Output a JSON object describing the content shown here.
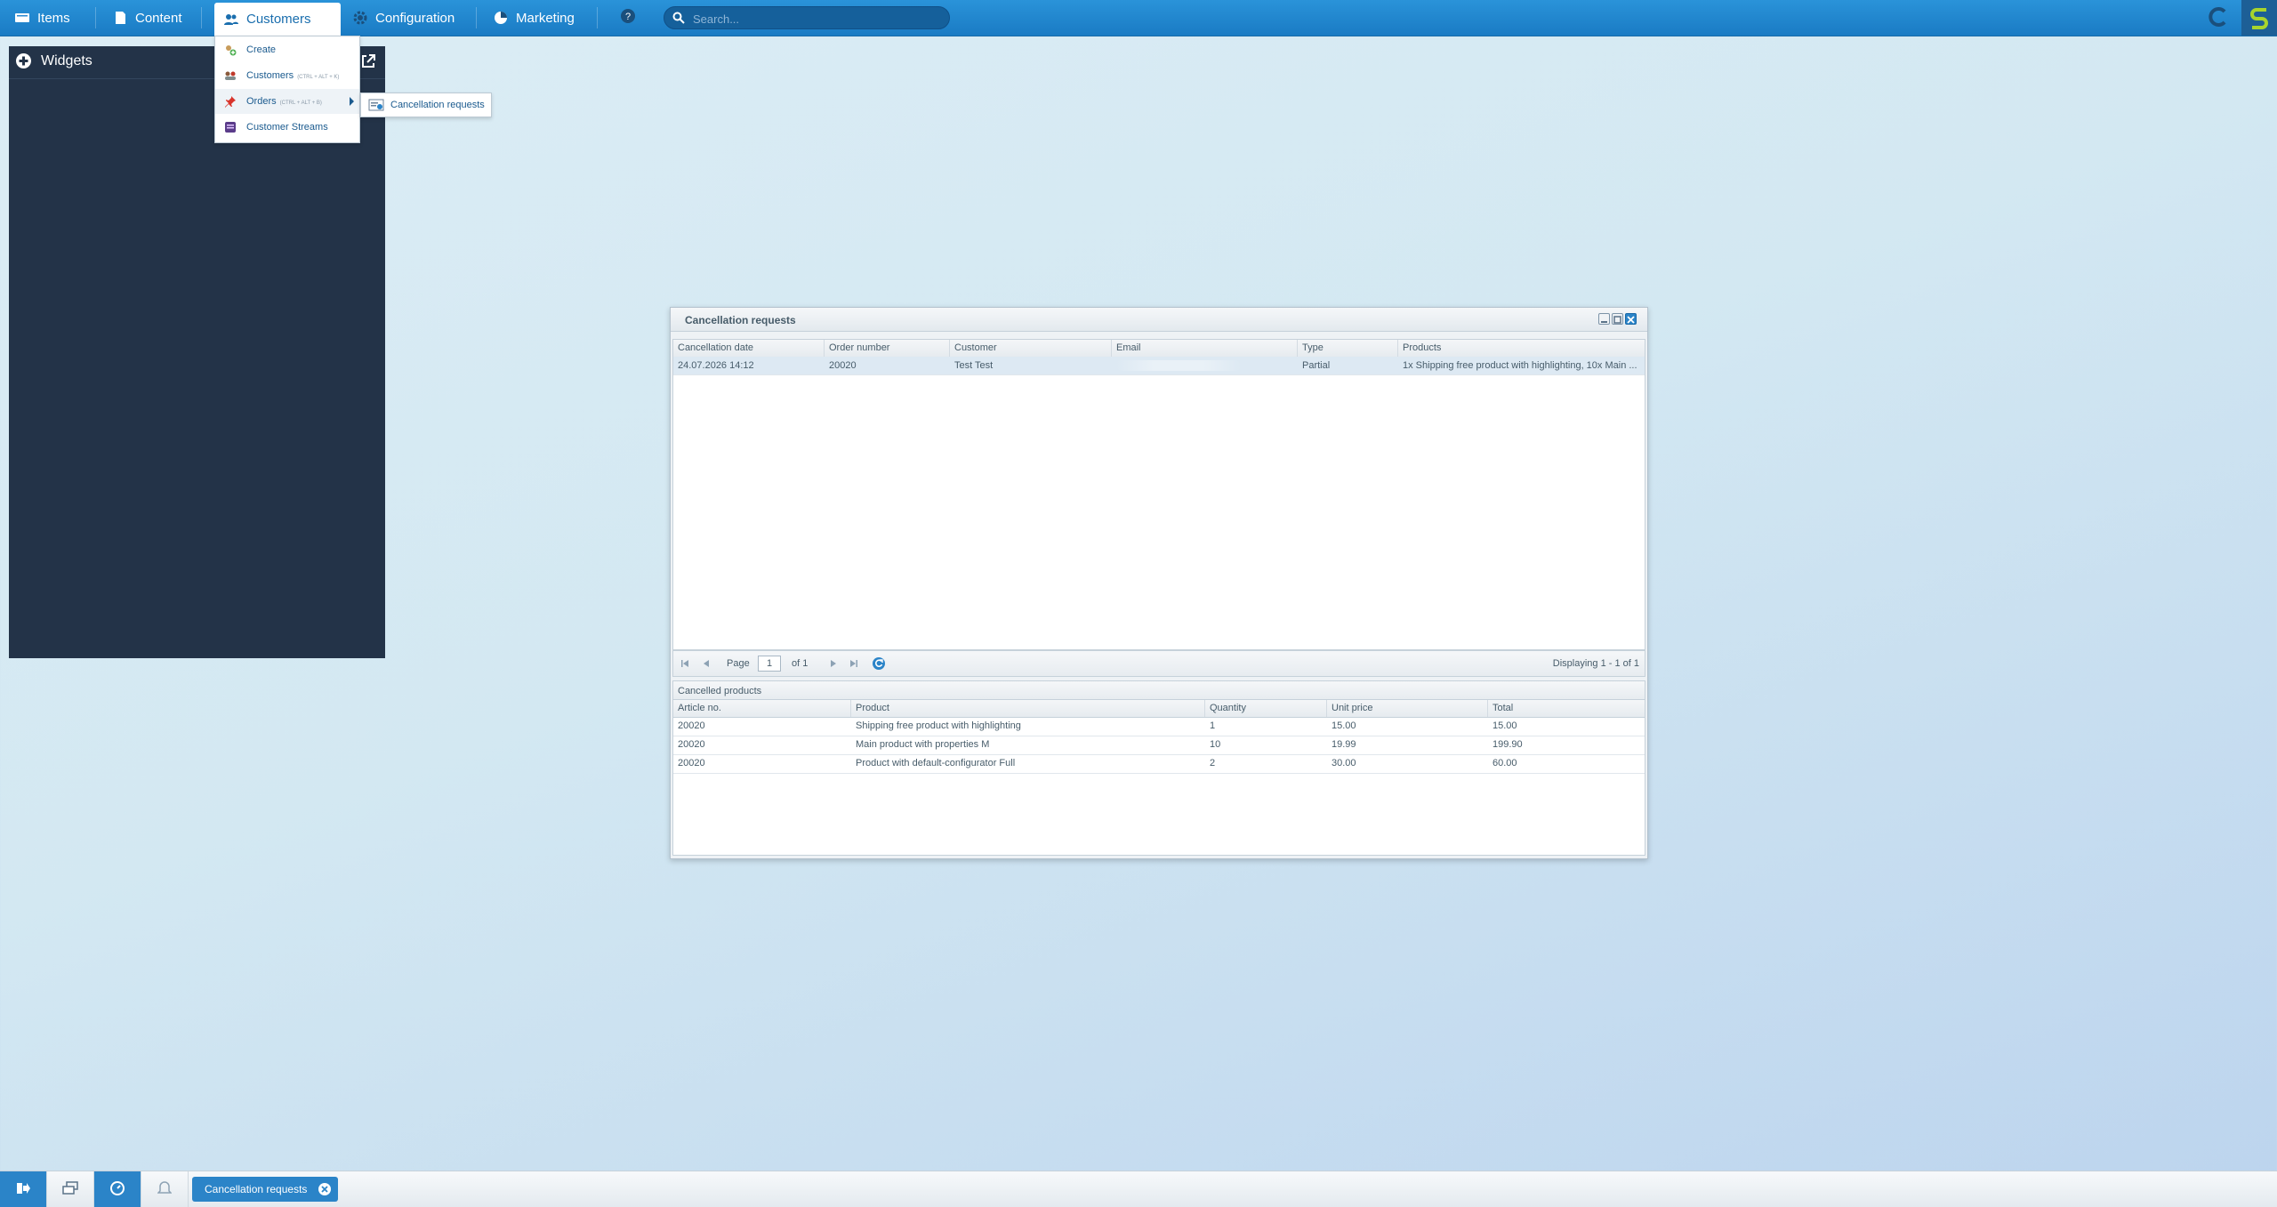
{
  "topbar": {
    "nav": [
      {
        "label": "Items",
        "icon": "items-icon"
      },
      {
        "label": "Content",
        "icon": "content-icon"
      },
      {
        "label": "Customers",
        "icon": "customers-icon"
      },
      {
        "label": "Configuration",
        "icon": "gear-icon"
      },
      {
        "label": "Marketing",
        "icon": "marketing-icon"
      }
    ],
    "help_icon": "help-icon",
    "search": {
      "placeholder": "Search...",
      "value": ""
    }
  },
  "customers_menu": {
    "items": [
      {
        "label": "Create",
        "shortcut": ""
      },
      {
        "label": "Customers",
        "shortcut": "(CTRL + ALT + K)"
      },
      {
        "label": "Orders",
        "shortcut": "(CTRL + ALT + B)"
      },
      {
        "label": "Customer Streams",
        "shortcut": ""
      }
    ],
    "submenu": {
      "label": "Cancellation requests"
    }
  },
  "widgets": {
    "title": "Widgets"
  },
  "window": {
    "title": "Cancellation requests",
    "columns": [
      "Cancellation date",
      "Order number",
      "Customer",
      "Email",
      "Type",
      "Products"
    ],
    "rows": [
      {
        "date": "24.07.2026 14:12",
        "order_number": "20020",
        "customer": "Test Test",
        "email": "",
        "type": "Partial",
        "products": "1x Shipping free product with highlighting, 10x Main ..."
      }
    ],
    "pager": {
      "page_label": "Page",
      "page_value": "1",
      "of_label": "of 1",
      "display": "Displaying 1 - 1 of 1"
    },
    "cancelled_products": {
      "title": "Cancelled products",
      "columns": [
        "Article no.",
        "Product",
        "Quantity",
        "Unit price",
        "Total"
      ],
      "rows": [
        {
          "article": "20020",
          "product": "Shipping free product with highlighting",
          "quantity": "1",
          "unit_price": "15.00",
          "total": "15.00"
        },
        {
          "article": "20020",
          "product": "Main product with properties M",
          "quantity": "10",
          "unit_price": "19.99",
          "total": "199.90"
        },
        {
          "article": "20020",
          "product": "Product with default-configurator Full",
          "quantity": "2",
          "unit_price": "30.00",
          "total": "60.00"
        }
      ]
    }
  },
  "taskbar": {
    "task_label": "Cancellation requests"
  },
  "colors": {
    "accent": "#2b84c8",
    "topbar": "#1a7bc4",
    "widgets_bg": "#233348"
  }
}
